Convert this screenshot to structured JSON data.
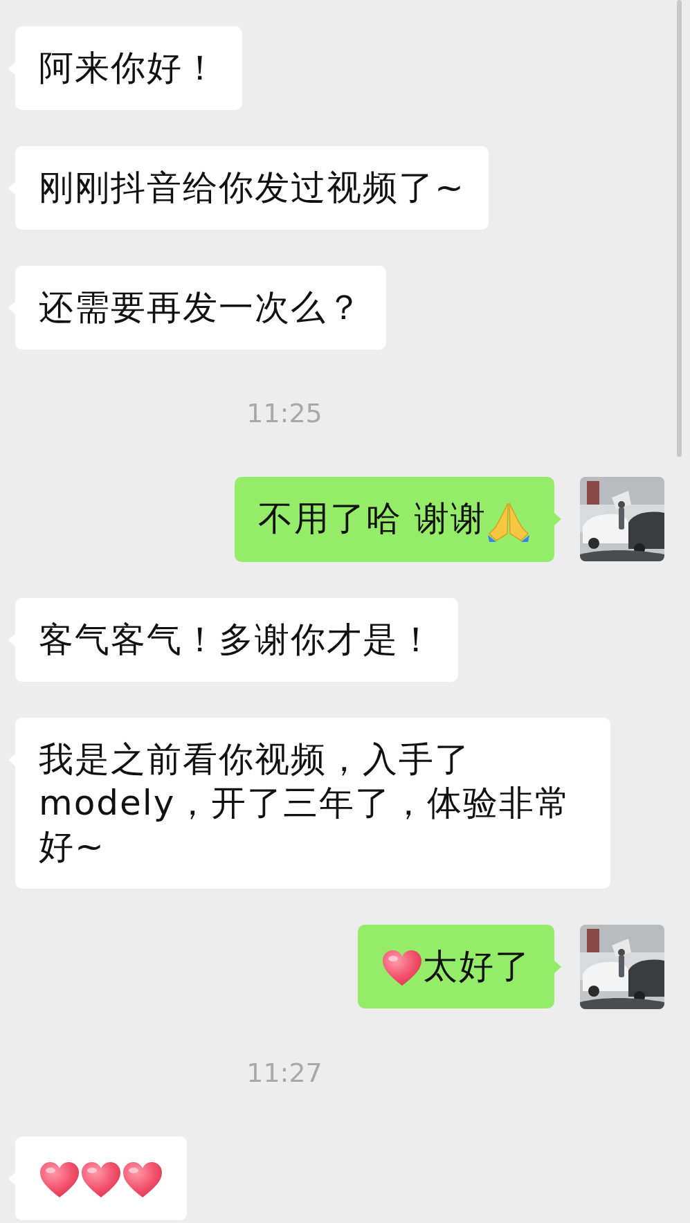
{
  "messages": [
    {
      "kind": "received",
      "parts": [
        {
          "kind": "text",
          "text": "阿来你好！"
        }
      ]
    },
    {
      "kind": "received",
      "parts": [
        {
          "kind": "text",
          "text": "刚刚抖音给你发过视频了~"
        }
      ]
    },
    {
      "kind": "received",
      "parts": [
        {
          "kind": "text",
          "text": "还需要再发一次么？"
        }
      ]
    },
    {
      "kind": "time",
      "text": "11:25"
    },
    {
      "kind": "sent",
      "avatar": {
        "kind": "picture"
      },
      "parts": [
        {
          "kind": "text",
          "text": "不用了哈 谢谢"
        },
        {
          "kind": "pray"
        }
      ]
    },
    {
      "kind": "received",
      "parts": [
        {
          "kind": "text",
          "text": "客气客气！多谢你才是！"
        }
      ]
    },
    {
      "kind": "received",
      "parts": [
        {
          "kind": "text",
          "text": "我是之前看你视频，入手了modely，开了三年了，体验非常好~"
        }
      ]
    },
    {
      "kind": "sent",
      "avatar": {
        "kind": "picture"
      },
      "parts": [
        {
          "kind": "heart"
        },
        {
          "kind": "text",
          "text": "太好了"
        }
      ]
    },
    {
      "kind": "time",
      "text": "11:27"
    },
    {
      "kind": "received",
      "parts": [
        {
          "kind": "heart"
        },
        {
          "kind": "heart"
        },
        {
          "kind": "heart"
        }
      ]
    }
  ]
}
